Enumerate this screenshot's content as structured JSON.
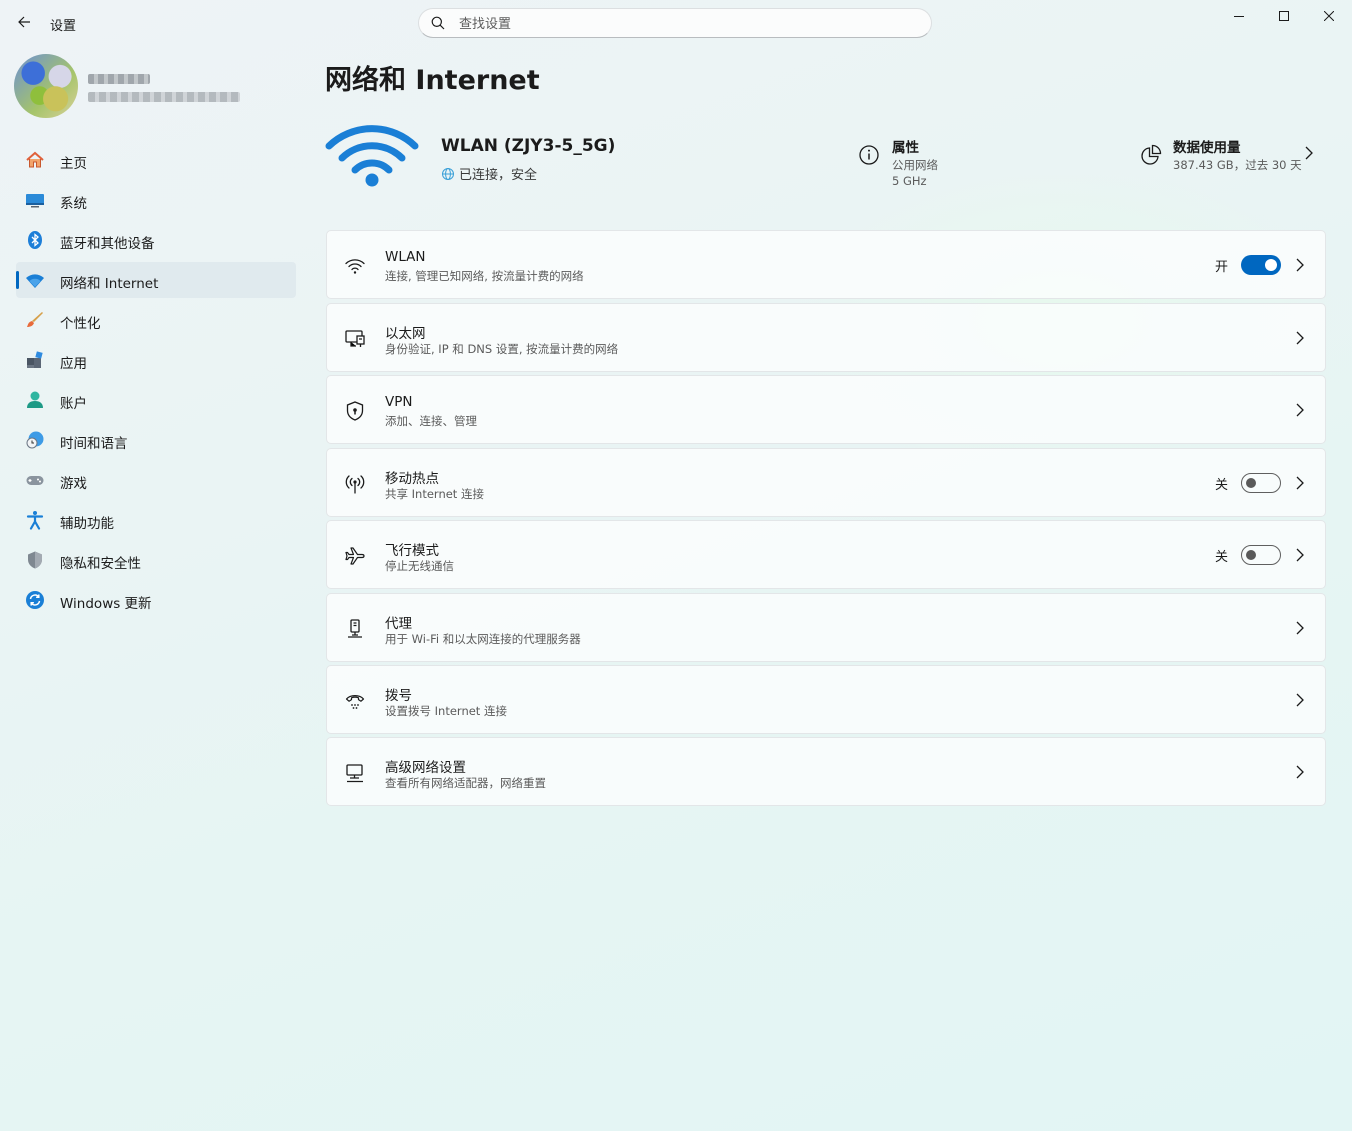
{
  "window": {
    "app_title": "设置",
    "search_placeholder": "查找设置"
  },
  "sidebar": {
    "items": [
      {
        "label": "主页",
        "icon": "home-icon"
      },
      {
        "label": "系统",
        "icon": "system-icon"
      },
      {
        "label": "蓝牙和其他设备",
        "icon": "bluetooth-icon"
      },
      {
        "label": "网络和 Internet",
        "icon": "wifi-icon",
        "selected": true
      },
      {
        "label": "个性化",
        "icon": "brush-icon"
      },
      {
        "label": "应用",
        "icon": "apps-icon"
      },
      {
        "label": "账户",
        "icon": "account-icon"
      },
      {
        "label": "时间和语言",
        "icon": "time-language-icon"
      },
      {
        "label": "游戏",
        "icon": "gamepad-icon"
      },
      {
        "label": "辅助功能",
        "icon": "accessibility-icon"
      },
      {
        "label": "隐私和安全性",
        "icon": "shield-icon"
      },
      {
        "label": "Windows 更新",
        "icon": "update-icon"
      }
    ]
  },
  "main": {
    "page_title": "网络和 Internet",
    "connection": {
      "name": "WLAN (ZJY3-5_5G)",
      "status": "已连接，安全"
    },
    "properties": {
      "title": "属性",
      "network_type": "公用网络",
      "band": "5 GHz"
    },
    "data_usage": {
      "title": "数据使用量",
      "detail": "387.43 GB，过去 30 天"
    },
    "cards": [
      {
        "title": "WLAN",
        "subtitle": "连接, 管理已知网络, 按流量计费的网络",
        "icon": "wifi-icon",
        "toggle_label": "开",
        "toggle_on": true
      },
      {
        "title": "以太网",
        "subtitle": "身份验证, IP 和 DNS 设置, 按流量计费的网络",
        "icon": "ethernet-icon"
      },
      {
        "title": "VPN",
        "subtitle": "添加、连接、管理",
        "icon": "vpn-shield-icon"
      },
      {
        "title": "移动热点",
        "subtitle": "共享 Internet 连接",
        "icon": "hotspot-icon",
        "toggle_label": "关",
        "toggle_on": false
      },
      {
        "title": "飞行模式",
        "subtitle": "停止无线通信",
        "icon": "airplane-icon",
        "toggle_label": "关",
        "toggle_on": false
      },
      {
        "title": "代理",
        "subtitle": "用于 Wi-Fi 和以太网连接的代理服务器",
        "icon": "proxy-icon"
      },
      {
        "title": "拨号",
        "subtitle": "设置拨号 Internet 连接",
        "icon": "dialup-icon"
      },
      {
        "title": "高级网络设置",
        "subtitle": "查看所有网络适配器，网络重置",
        "icon": "advanced-network-icon"
      }
    ]
  },
  "colors": {
    "accent": "#0067c0",
    "wifi_hero": "#1a7fd6"
  }
}
